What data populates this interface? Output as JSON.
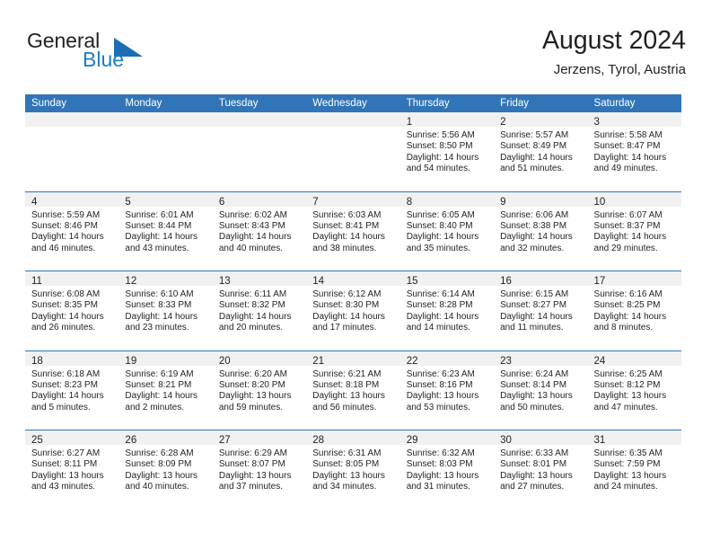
{
  "brand": {
    "name_top": "General",
    "name_bottom": "Blue",
    "color_dark": "#231f20",
    "color_blue": "#1a7fc1",
    "triangle_color": "#1b6eb3"
  },
  "header": {
    "title": "August 2024",
    "subtitle": "Jerzens, Tyrol, Austria"
  },
  "theme": {
    "header_blue": "#3175b8",
    "band_gray": "#f1f1f1",
    "text": "#231f20"
  },
  "weekdays": [
    "Sunday",
    "Monday",
    "Tuesday",
    "Wednesday",
    "Thursday",
    "Friday",
    "Saturday"
  ],
  "weeks": [
    [
      {
        "day": "",
        "sunrise": "",
        "sunset": "",
        "daylight_line1": "",
        "daylight_line2": ""
      },
      {
        "day": "",
        "sunrise": "",
        "sunset": "",
        "daylight_line1": "",
        "daylight_line2": ""
      },
      {
        "day": "",
        "sunrise": "",
        "sunset": "",
        "daylight_line1": "",
        "daylight_line2": ""
      },
      {
        "day": "",
        "sunrise": "",
        "sunset": "",
        "daylight_line1": "",
        "daylight_line2": ""
      },
      {
        "day": "1",
        "sunrise": "Sunrise: 5:56 AM",
        "sunset": "Sunset: 8:50 PM",
        "daylight_line1": "Daylight: 14 hours",
        "daylight_line2": "and 54 minutes."
      },
      {
        "day": "2",
        "sunrise": "Sunrise: 5:57 AM",
        "sunset": "Sunset: 8:49 PM",
        "daylight_line1": "Daylight: 14 hours",
        "daylight_line2": "and 51 minutes."
      },
      {
        "day": "3",
        "sunrise": "Sunrise: 5:58 AM",
        "sunset": "Sunset: 8:47 PM",
        "daylight_line1": "Daylight: 14 hours",
        "daylight_line2": "and 49 minutes."
      }
    ],
    [
      {
        "day": "4",
        "sunrise": "Sunrise: 5:59 AM",
        "sunset": "Sunset: 8:46 PM",
        "daylight_line1": "Daylight: 14 hours",
        "daylight_line2": "and 46 minutes."
      },
      {
        "day": "5",
        "sunrise": "Sunrise: 6:01 AM",
        "sunset": "Sunset: 8:44 PM",
        "daylight_line1": "Daylight: 14 hours",
        "daylight_line2": "and 43 minutes."
      },
      {
        "day": "6",
        "sunrise": "Sunrise: 6:02 AM",
        "sunset": "Sunset: 8:43 PM",
        "daylight_line1": "Daylight: 14 hours",
        "daylight_line2": "and 40 minutes."
      },
      {
        "day": "7",
        "sunrise": "Sunrise: 6:03 AM",
        "sunset": "Sunset: 8:41 PM",
        "daylight_line1": "Daylight: 14 hours",
        "daylight_line2": "and 38 minutes."
      },
      {
        "day": "8",
        "sunrise": "Sunrise: 6:05 AM",
        "sunset": "Sunset: 8:40 PM",
        "daylight_line1": "Daylight: 14 hours",
        "daylight_line2": "and 35 minutes."
      },
      {
        "day": "9",
        "sunrise": "Sunrise: 6:06 AM",
        "sunset": "Sunset: 8:38 PM",
        "daylight_line1": "Daylight: 14 hours",
        "daylight_line2": "and 32 minutes."
      },
      {
        "day": "10",
        "sunrise": "Sunrise: 6:07 AM",
        "sunset": "Sunset: 8:37 PM",
        "daylight_line1": "Daylight: 14 hours",
        "daylight_line2": "and 29 minutes."
      }
    ],
    [
      {
        "day": "11",
        "sunrise": "Sunrise: 6:08 AM",
        "sunset": "Sunset: 8:35 PM",
        "daylight_line1": "Daylight: 14 hours",
        "daylight_line2": "and 26 minutes."
      },
      {
        "day": "12",
        "sunrise": "Sunrise: 6:10 AM",
        "sunset": "Sunset: 8:33 PM",
        "daylight_line1": "Daylight: 14 hours",
        "daylight_line2": "and 23 minutes."
      },
      {
        "day": "13",
        "sunrise": "Sunrise: 6:11 AM",
        "sunset": "Sunset: 8:32 PM",
        "daylight_line1": "Daylight: 14 hours",
        "daylight_line2": "and 20 minutes."
      },
      {
        "day": "14",
        "sunrise": "Sunrise: 6:12 AM",
        "sunset": "Sunset: 8:30 PM",
        "daylight_line1": "Daylight: 14 hours",
        "daylight_line2": "and 17 minutes."
      },
      {
        "day": "15",
        "sunrise": "Sunrise: 6:14 AM",
        "sunset": "Sunset: 8:28 PM",
        "daylight_line1": "Daylight: 14 hours",
        "daylight_line2": "and 14 minutes."
      },
      {
        "day": "16",
        "sunrise": "Sunrise: 6:15 AM",
        "sunset": "Sunset: 8:27 PM",
        "daylight_line1": "Daylight: 14 hours",
        "daylight_line2": "and 11 minutes."
      },
      {
        "day": "17",
        "sunrise": "Sunrise: 6:16 AM",
        "sunset": "Sunset: 8:25 PM",
        "daylight_line1": "Daylight: 14 hours",
        "daylight_line2": "and 8 minutes."
      }
    ],
    [
      {
        "day": "18",
        "sunrise": "Sunrise: 6:18 AM",
        "sunset": "Sunset: 8:23 PM",
        "daylight_line1": "Daylight: 14 hours",
        "daylight_line2": "and 5 minutes."
      },
      {
        "day": "19",
        "sunrise": "Sunrise: 6:19 AM",
        "sunset": "Sunset: 8:21 PM",
        "daylight_line1": "Daylight: 14 hours",
        "daylight_line2": "and 2 minutes."
      },
      {
        "day": "20",
        "sunrise": "Sunrise: 6:20 AM",
        "sunset": "Sunset: 8:20 PM",
        "daylight_line1": "Daylight: 13 hours",
        "daylight_line2": "and 59 minutes."
      },
      {
        "day": "21",
        "sunrise": "Sunrise: 6:21 AM",
        "sunset": "Sunset: 8:18 PM",
        "daylight_line1": "Daylight: 13 hours",
        "daylight_line2": "and 56 minutes."
      },
      {
        "day": "22",
        "sunrise": "Sunrise: 6:23 AM",
        "sunset": "Sunset: 8:16 PM",
        "daylight_line1": "Daylight: 13 hours",
        "daylight_line2": "and 53 minutes."
      },
      {
        "day": "23",
        "sunrise": "Sunrise: 6:24 AM",
        "sunset": "Sunset: 8:14 PM",
        "daylight_line1": "Daylight: 13 hours",
        "daylight_line2": "and 50 minutes."
      },
      {
        "day": "24",
        "sunrise": "Sunrise: 6:25 AM",
        "sunset": "Sunset: 8:12 PM",
        "daylight_line1": "Daylight: 13 hours",
        "daylight_line2": "and 47 minutes."
      }
    ],
    [
      {
        "day": "25",
        "sunrise": "Sunrise: 6:27 AM",
        "sunset": "Sunset: 8:11 PM",
        "daylight_line1": "Daylight: 13 hours",
        "daylight_line2": "and 43 minutes."
      },
      {
        "day": "26",
        "sunrise": "Sunrise: 6:28 AM",
        "sunset": "Sunset: 8:09 PM",
        "daylight_line1": "Daylight: 13 hours",
        "daylight_line2": "and 40 minutes."
      },
      {
        "day": "27",
        "sunrise": "Sunrise: 6:29 AM",
        "sunset": "Sunset: 8:07 PM",
        "daylight_line1": "Daylight: 13 hours",
        "daylight_line2": "and 37 minutes."
      },
      {
        "day": "28",
        "sunrise": "Sunrise: 6:31 AM",
        "sunset": "Sunset: 8:05 PM",
        "daylight_line1": "Daylight: 13 hours",
        "daylight_line2": "and 34 minutes."
      },
      {
        "day": "29",
        "sunrise": "Sunrise: 6:32 AM",
        "sunset": "Sunset: 8:03 PM",
        "daylight_line1": "Daylight: 13 hours",
        "daylight_line2": "and 31 minutes."
      },
      {
        "day": "30",
        "sunrise": "Sunrise: 6:33 AM",
        "sunset": "Sunset: 8:01 PM",
        "daylight_line1": "Daylight: 13 hours",
        "daylight_line2": "and 27 minutes."
      },
      {
        "day": "31",
        "sunrise": "Sunrise: 6:35 AM",
        "sunset": "Sunset: 7:59 PM",
        "daylight_line1": "Daylight: 13 hours",
        "daylight_line2": "and 24 minutes."
      }
    ]
  ]
}
